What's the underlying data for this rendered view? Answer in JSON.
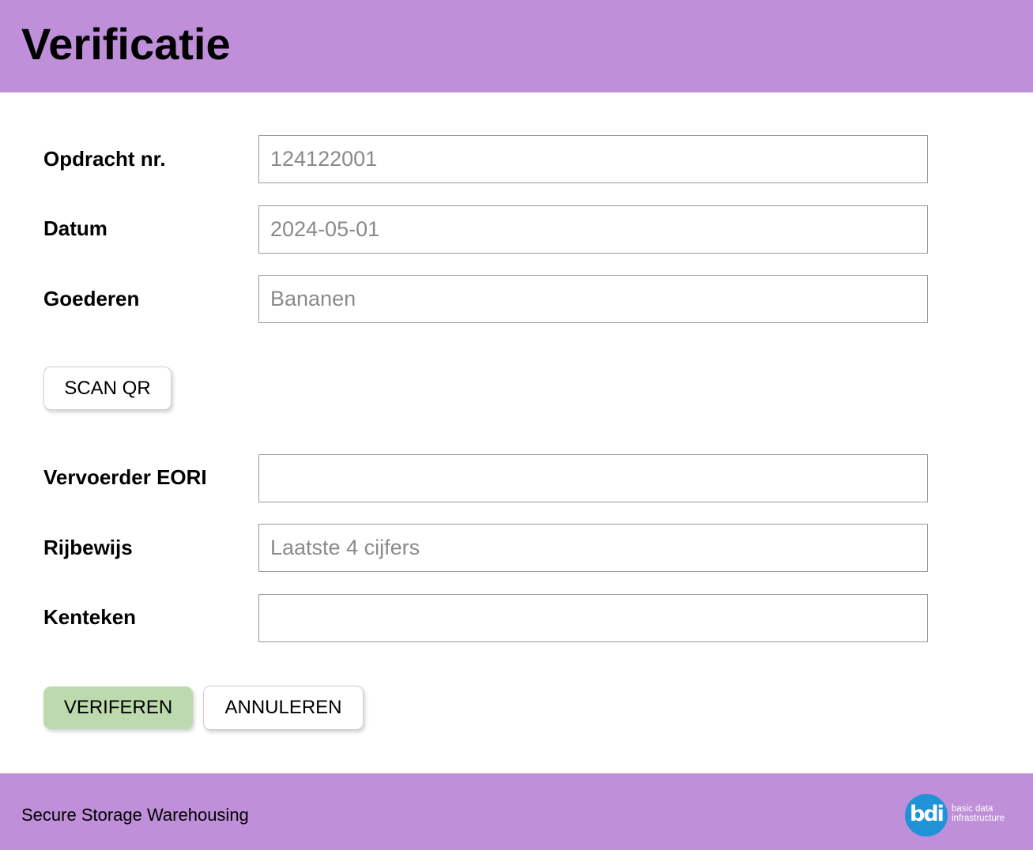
{
  "header": {
    "title": "Verificatie"
  },
  "form": {
    "opdracht": {
      "label": "Opdracht nr.",
      "value": "",
      "placeholder": "124122001"
    },
    "datum": {
      "label": "Datum",
      "value": "",
      "placeholder": "2024-05-01"
    },
    "goederen": {
      "label": "Goederen",
      "value": "",
      "placeholder": "Bananen"
    },
    "scan_button": "SCAN QR",
    "eori": {
      "label": "Vervoerder EORI",
      "value": "",
      "placeholder": ""
    },
    "rijbewijs": {
      "label": "Rijbewijs",
      "value": "",
      "placeholder": "Laatste 4 cijfers"
    },
    "kenteken": {
      "label": "Kenteken",
      "value": "",
      "placeholder": ""
    },
    "verify_button": "VERIFEREN",
    "cancel_button": "ANNULEREN"
  },
  "footer": {
    "company": "Secure Storage Warehousing",
    "logo": {
      "mark": "bdi",
      "line1": "basic data",
      "line2": "infrastructure"
    }
  },
  "colors": {
    "header_bg": "#bf8fd9",
    "footer_bg": "#bf8fd9",
    "primary_button": "#bcdaad",
    "logo_blue": "#1f93d6"
  }
}
